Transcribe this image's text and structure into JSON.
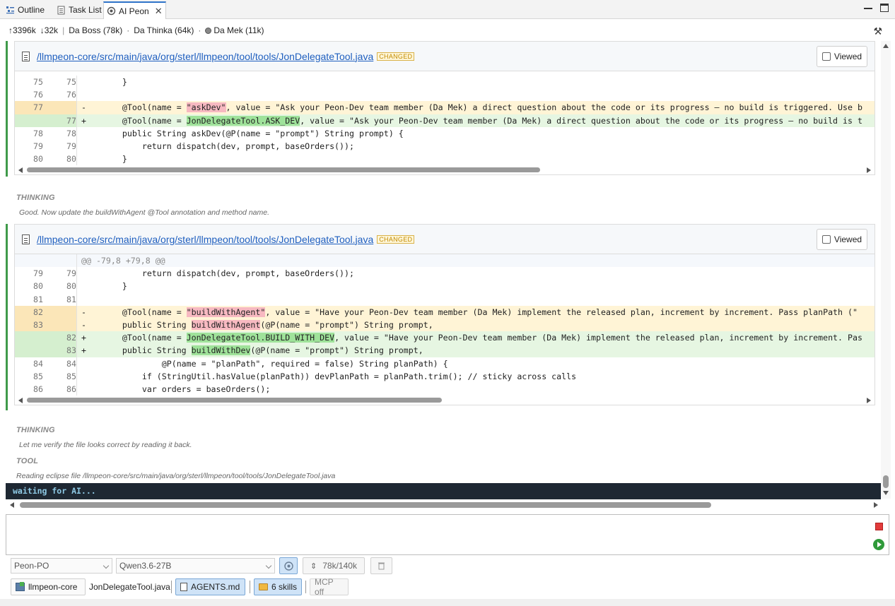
{
  "tabs": [
    {
      "label": "Outline",
      "icon": "outline-icon"
    },
    {
      "label": "Task List",
      "icon": "task-list-icon"
    },
    {
      "label": "AI Peon",
      "icon": "ai-peon-icon",
      "active": true
    }
  ],
  "stats": {
    "up": "↑3396k",
    "down": "↓32k",
    "boss": "Da Boss (78k)",
    "sep1": "·",
    "thinka": "Da Thinka (64k)",
    "sep2": "·",
    "mek": "Da Mek (11k)"
  },
  "diff1": {
    "file": "/llmpeon-core/src/main/java/org/sterl/llmpeon/tool/tools/JonDelegateTool.java",
    "badge": "CHANGED",
    "viewed_label": "Viewed",
    "rows": [
      {
        "type": "ctx",
        "o": "75",
        "n": "75",
        "text": "    }"
      },
      {
        "type": "ctx",
        "o": "76",
        "n": "76",
        "text": ""
      },
      {
        "type": "del",
        "o": "77",
        "n": "",
        "sign": "-",
        "pre": "    @Tool(name = ",
        "hl": "\"askDev\"",
        "post": ", value = \"Ask your Peon-Dev team member (Da Mek) a direct question about the code or its progress — no build is triggered. Use b"
      },
      {
        "type": "add",
        "o": "",
        "n": "77",
        "sign": "+",
        "pre": "    @Tool(name = ",
        "hl": "JonDelegateTool.ASK_DEV",
        "post": ", value = \"Ask your Peon-Dev team member (Da Mek) a direct question about the code or its progress — no build is t"
      },
      {
        "type": "ctx",
        "o": "78",
        "n": "78",
        "text": "    public String askDev(@P(name = \"prompt\") String prompt) {"
      },
      {
        "type": "ctx",
        "o": "79",
        "n": "79",
        "text": "        return dispatch(dev, prompt, baseOrders());"
      },
      {
        "type": "ctx",
        "o": "80",
        "n": "80",
        "text": "    }"
      }
    ]
  },
  "thinking1": {
    "label": "THINKING",
    "text": "Good. Now update the buildWithAgent @Tool annotation and method name."
  },
  "diff2": {
    "file": "/llmpeon-core/src/main/java/org/sterl/llmpeon/tool/tools/JonDelegateTool.java",
    "badge": "CHANGED",
    "viewed_label": "Viewed",
    "hunk": "@@ -79,8 +79,8 @@",
    "rows": [
      {
        "type": "ctx",
        "o": "79",
        "n": "79",
        "text": "        return dispatch(dev, prompt, baseOrders());"
      },
      {
        "type": "ctx",
        "o": "80",
        "n": "80",
        "text": "    }"
      },
      {
        "type": "ctx",
        "o": "81",
        "n": "81",
        "text": ""
      },
      {
        "type": "del",
        "o": "82",
        "n": "",
        "sign": "-",
        "pre": "    @Tool(name = ",
        "hl": "\"buildWithAgent\"",
        "post": ", value = \"Have your Peon-Dev team member (Da Mek) implement the released plan, increment by increment. Pass planPath (\""
      },
      {
        "type": "del",
        "o": "83",
        "n": "",
        "sign": "-",
        "pre": "    public String ",
        "hl": "buildWithAgent",
        "post": "(@P(name = \"prompt\") String prompt,"
      },
      {
        "type": "add",
        "o": "",
        "n": "82",
        "sign": "+",
        "pre": "    @Tool(name = ",
        "hl": "JonDelegateTool.BUILD_WITH_DEV",
        "post": ", value = \"Have your Peon-Dev team member (Da Mek) implement the released plan, increment by increment. Pas"
      },
      {
        "type": "add",
        "o": "",
        "n": "83",
        "sign": "+",
        "pre": "    public String ",
        "hl": "buildWithDev",
        "post": "(@P(name = \"prompt\") String prompt,"
      },
      {
        "type": "ctx",
        "o": "84",
        "n": "84",
        "text": "            @P(name = \"planPath\", required = false) String planPath) {"
      },
      {
        "type": "ctx",
        "o": "85",
        "n": "85",
        "text": "        if (StringUtil.hasValue(planPath)) devPlanPath = planPath.trim(); // sticky across calls"
      },
      {
        "type": "ctx",
        "o": "86",
        "n": "86",
        "text": "        var orders = baseOrders();"
      }
    ]
  },
  "thinking2": {
    "label": "THINKING",
    "text": "Let me verify the file looks correct by reading it back."
  },
  "tool": {
    "label": "TOOL",
    "text": "Reading eclipse file /llmpeon-core/src/main/java/org/sterl/llmpeon/tool/tools/JonDelegateTool.java"
  },
  "status": "waiting for AI...",
  "input": {
    "value": "",
    "placeholder": ""
  },
  "controls": {
    "agent": "Peon-PO",
    "model": "Qwen3.6-27B",
    "tokens": "78k/140k",
    "project": "llmpeon-core",
    "current_file": "JonDelegateTool.java",
    "agents_md": "AGENTS.md",
    "skills": "6 skills",
    "mcp": "MCP off"
  },
  "colors": {
    "accent": "#2f73c9",
    "added": "#e6f6e2",
    "removed": "#fff4d6",
    "status_bg": "#1e2833",
    "status_fg": "#8ecae6"
  }
}
